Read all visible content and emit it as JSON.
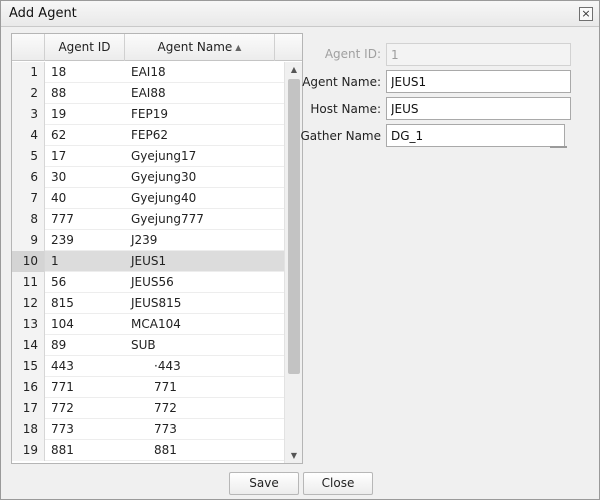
{
  "dialog": {
    "title": "Add Agent",
    "close_glyph": "×"
  },
  "grid": {
    "columns": {
      "id": "Agent ID",
      "name": "Agent Name"
    },
    "sort": {
      "column": "name",
      "direction": "asc"
    },
    "selected_index": 9,
    "rows": [
      {
        "n": "1",
        "id": "18",
        "name": "EAI18"
      },
      {
        "n": "2",
        "id": "88",
        "name": "EAI88"
      },
      {
        "n": "3",
        "id": "19",
        "name": "FEP19"
      },
      {
        "n": "4",
        "id": "62",
        "name": "FEP62"
      },
      {
        "n": "5",
        "id": "17",
        "name": "Gyejung17"
      },
      {
        "n": "6",
        "id": "30",
        "name": "Gyejung30"
      },
      {
        "n": "7",
        "id": "40",
        "name": "Gyejung40"
      },
      {
        "n": "8",
        "id": "777",
        "name": "Gyejung777"
      },
      {
        "n": "9",
        "id": "239",
        "name": "J239"
      },
      {
        "n": "10",
        "id": "1",
        "name": "JEUS1"
      },
      {
        "n": "11",
        "id": "56",
        "name": "JEUS56"
      },
      {
        "n": "12",
        "id": "815",
        "name": "JEUS815"
      },
      {
        "n": "13",
        "id": "104",
        "name": "MCA104"
      },
      {
        "n": "14",
        "id": "89",
        "name": "SUB"
      },
      {
        "n": "15",
        "id": "443",
        "name": "·443",
        "indent": true
      },
      {
        "n": "16",
        "id": "771",
        "name": "771",
        "indent": true
      },
      {
        "n": "17",
        "id": "772",
        "name": "772",
        "indent": true
      },
      {
        "n": "18",
        "id": "773",
        "name": "773",
        "indent": true
      },
      {
        "n": "19",
        "id": "881",
        "name": "881",
        "indent": true
      }
    ]
  },
  "form": {
    "agent_id": {
      "label": "Agent ID:",
      "value": "1",
      "disabled": true
    },
    "agent_name": {
      "label": "Agent Name:",
      "value": "JEUS1"
    },
    "host_name": {
      "label": "Host Name:",
      "value": "JEUS"
    },
    "gather_name": {
      "label": "Gather Name",
      "value": "DG_1"
    }
  },
  "buttons": {
    "save": "Save",
    "close": "Close"
  },
  "icons": {
    "sort": "sort-ascending-icon",
    "scroll_up": "chevron-up-icon",
    "scroll_down": "chevron-down-icon",
    "close": "close-icon"
  }
}
